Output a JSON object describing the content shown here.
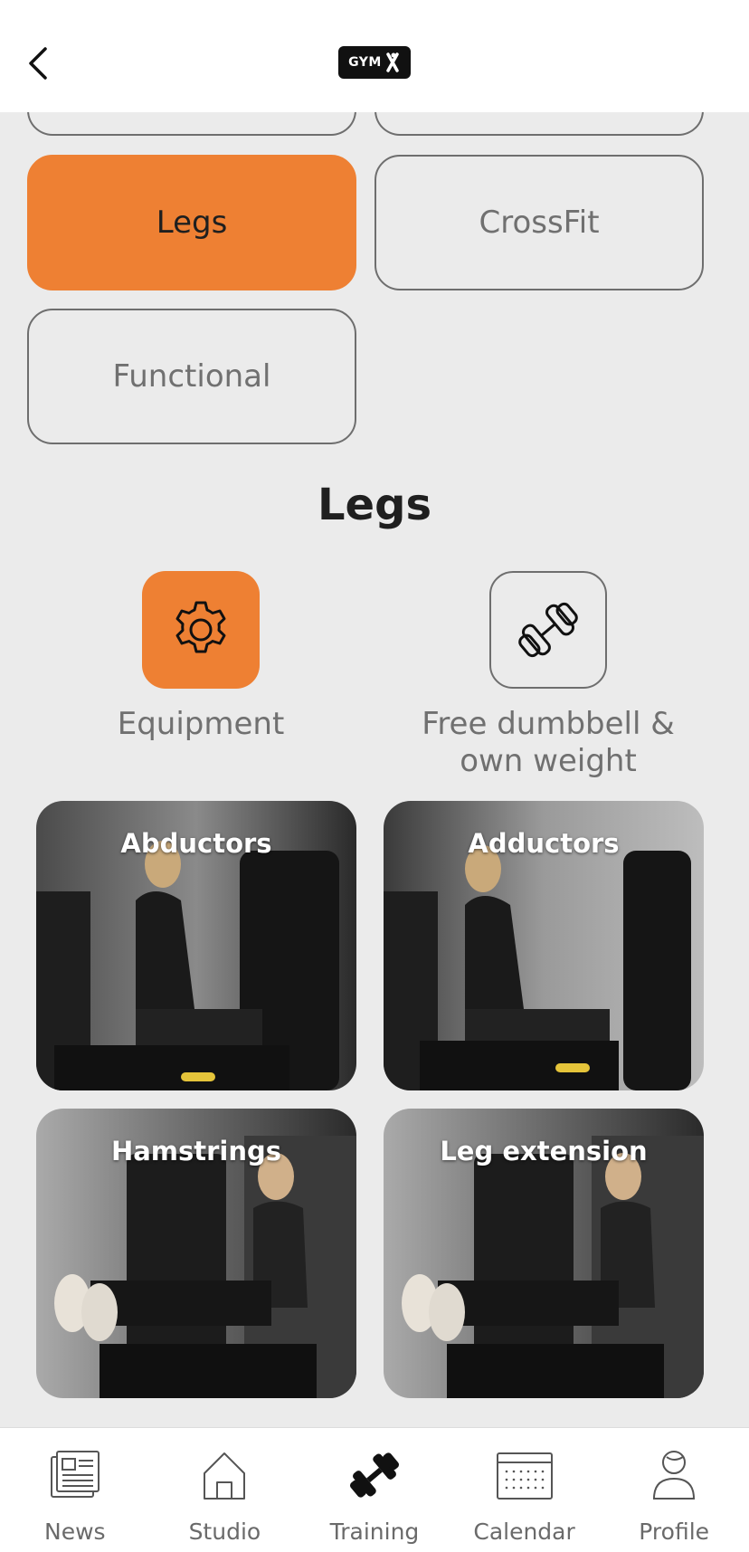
{
  "header": {
    "logo_text": "GYM"
  },
  "categories": [
    {
      "label": "Legs",
      "active": true
    },
    {
      "label": "CrossFit",
      "active": false
    },
    {
      "label": "Functional",
      "active": false
    }
  ],
  "section_title": "Legs",
  "types": [
    {
      "label": "Equipment",
      "icon": "gear-icon",
      "active": true
    },
    {
      "label": "Free dumbbell & own weight",
      "icon": "dumbbell-icon",
      "active": false
    }
  ],
  "exercises": [
    {
      "title": "Abductors"
    },
    {
      "title": "Adductors"
    },
    {
      "title": "Hamstrings"
    },
    {
      "title": "Leg extension"
    }
  ],
  "nav": [
    {
      "label": "News",
      "icon": "newspaper-icon"
    },
    {
      "label": "Studio",
      "icon": "home-icon"
    },
    {
      "label": "Training",
      "icon": "dumbbell-icon",
      "active": true
    },
    {
      "label": "Calendar",
      "icon": "calendar-icon"
    },
    {
      "label": "Profile",
      "icon": "person-icon"
    }
  ],
  "colors": {
    "accent": "#ee8033",
    "background": "#ebebeb",
    "text_muted": "#707070"
  }
}
